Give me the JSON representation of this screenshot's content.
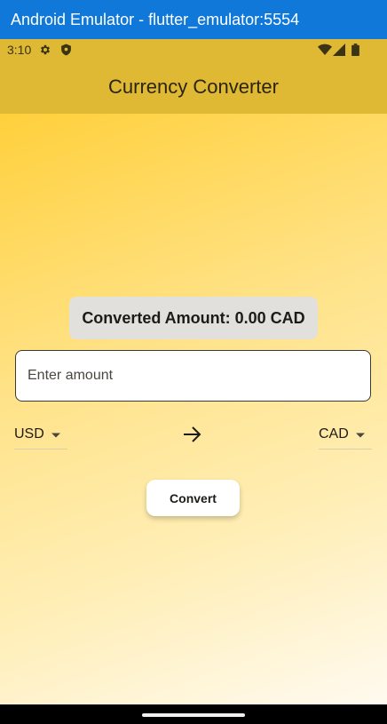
{
  "window": {
    "title": "Android Emulator - flutter_emulator:5554",
    "titlebar_color": "#0f78d9"
  },
  "status_bar": {
    "time": "3:10",
    "left_icons": [
      "settings-icon",
      "shield-icon"
    ],
    "right_icons": [
      "wifi-icon",
      "signal-icon",
      "battery-icon"
    ]
  },
  "app_bar": {
    "title": "Currency Converter",
    "color": "#dfb934"
  },
  "result": {
    "text": "Converted Amount: 0.00 CAD"
  },
  "amount_input": {
    "placeholder": "Enter amount",
    "value": ""
  },
  "from_currency": {
    "selected": "USD"
  },
  "to_currency": {
    "selected": "CAD"
  },
  "convert_button": {
    "label": "Convert"
  }
}
